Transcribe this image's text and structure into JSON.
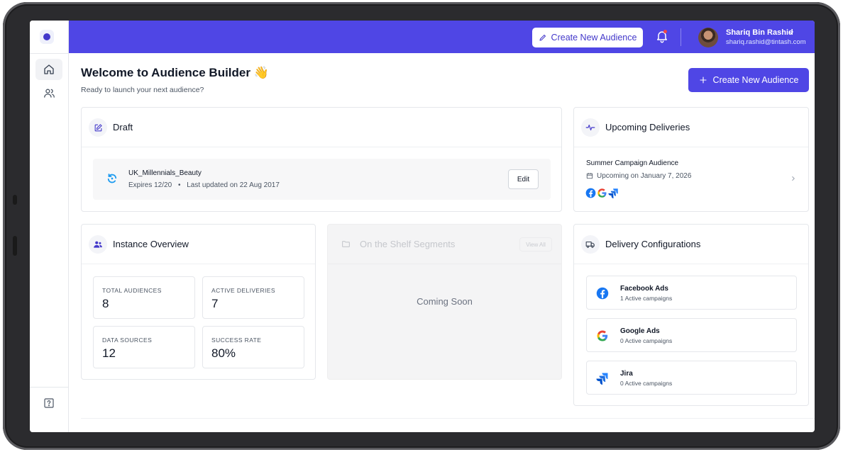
{
  "header": {
    "create_button": "Create New Audience",
    "user_name": "Shariq Bin Rashid",
    "user_email": "shariq.rashid@tintash.com"
  },
  "page": {
    "title": "Welcome to Audience Builder 👋",
    "subtitle": "Ready to launch your next audience?",
    "create_button": "Create New Audience"
  },
  "draft": {
    "title": "Draft",
    "item": {
      "name": "UK_Millennials_Beauty",
      "expires": "Expires 12/20",
      "updated": "Last updated on 22 Aug 2017",
      "edit": "Edit"
    }
  },
  "upcoming": {
    "title": "Upcoming Deliveries",
    "item": {
      "name": "Summer Campaign Audience",
      "date": "Upcoming on January 7, 2026"
    }
  },
  "overview": {
    "title": "Instance Overview",
    "stats": [
      {
        "label": "TOTAL AUDIENCES",
        "value": "8"
      },
      {
        "label": "ACTIVE DELIVERIES",
        "value": "7"
      },
      {
        "label": "DATA SOURCES",
        "value": "12"
      },
      {
        "label": "SUCCESS RATE",
        "value": "80%"
      }
    ]
  },
  "shelf": {
    "title": "On the Shelf Segments",
    "view_all": "View All",
    "coming_soon": "Coming Soon"
  },
  "delivery": {
    "title": "Delivery Configurations",
    "items": [
      {
        "name": "Facebook Ads",
        "sub": "1 Active campaigns",
        "icon": "facebook-icon"
      },
      {
        "name": "Google Ads",
        "sub": "0 Active campaigns",
        "icon": "google-icon"
      },
      {
        "name": "Jira",
        "sub": "0 Active campaigns",
        "icon": "jira-icon"
      }
    ]
  },
  "colors": {
    "primary": "#4f46e5",
    "facebook": "#1877f2",
    "jira": "#2684ff"
  }
}
